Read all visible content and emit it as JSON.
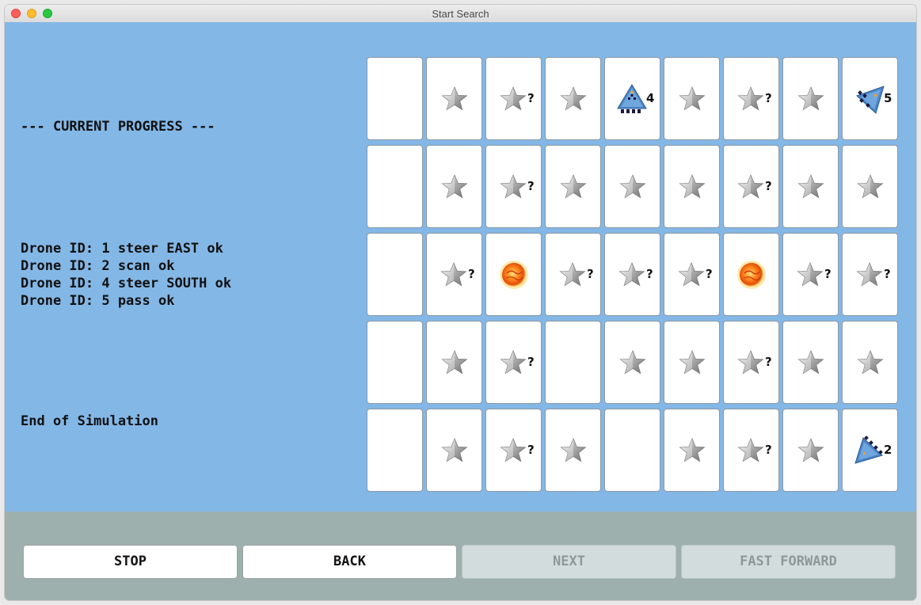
{
  "window": {
    "title": "Start Search"
  },
  "log": {
    "header": "--- CURRENT PROGRESS ---",
    "lines": [
      "Drone ID: 1 steer EAST ok",
      "Drone ID: 2 scan ok",
      "Drone ID: 4 steer SOUTH ok",
      "Drone ID: 5 pass ok"
    ],
    "footer": "End of Simulation"
  },
  "grid": {
    "rows": [
      [
        {
          "icon": "empty"
        },
        {
          "icon": "star"
        },
        {
          "icon": "star",
          "label": "?"
        },
        {
          "icon": "star"
        },
        {
          "icon": "drone-south-icon",
          "label": "4"
        },
        {
          "icon": "star"
        },
        {
          "icon": "star",
          "label": "?"
        },
        {
          "icon": "star"
        },
        {
          "icon": "drone-west-icon",
          "label": "5"
        }
      ],
      [
        {
          "icon": "empty"
        },
        {
          "icon": "star"
        },
        {
          "icon": "star",
          "label": "?"
        },
        {
          "icon": "star"
        },
        {
          "icon": "star"
        },
        {
          "icon": "star"
        },
        {
          "icon": "star",
          "label": "?"
        },
        {
          "icon": "star"
        },
        {
          "icon": "star"
        }
      ],
      [
        {
          "icon": "empty"
        },
        {
          "icon": "star",
          "label": "?"
        },
        {
          "icon": "sun"
        },
        {
          "icon": "star",
          "label": "?"
        },
        {
          "icon": "star",
          "label": "?"
        },
        {
          "icon": "star",
          "label": "?"
        },
        {
          "icon": "sun"
        },
        {
          "icon": "star",
          "label": "?"
        },
        {
          "icon": "star",
          "label": "?"
        }
      ],
      [
        {
          "icon": "empty"
        },
        {
          "icon": "star"
        },
        {
          "icon": "star",
          "label": "?"
        },
        {
          "icon": "empty"
        },
        {
          "icon": "star"
        },
        {
          "icon": "star"
        },
        {
          "icon": "star",
          "label": "?"
        },
        {
          "icon": "star"
        },
        {
          "icon": "star"
        }
      ],
      [
        {
          "icon": "empty"
        },
        {
          "icon": "star"
        },
        {
          "icon": "star",
          "label": "?"
        },
        {
          "icon": "star"
        },
        {
          "icon": "empty"
        },
        {
          "icon": "star"
        },
        {
          "icon": "star",
          "label": "?"
        },
        {
          "icon": "star"
        },
        {
          "icon": "drone-east-icon",
          "label": "2"
        }
      ]
    ]
  },
  "buttons": {
    "stop": "STOP",
    "back": "BACK",
    "next": "NEXT",
    "fast_forward": "FAST FORWARD"
  },
  "colors": {
    "panel": "#83b7e6",
    "footer": "#9eb0ad",
    "drone": "#4a86c8"
  }
}
